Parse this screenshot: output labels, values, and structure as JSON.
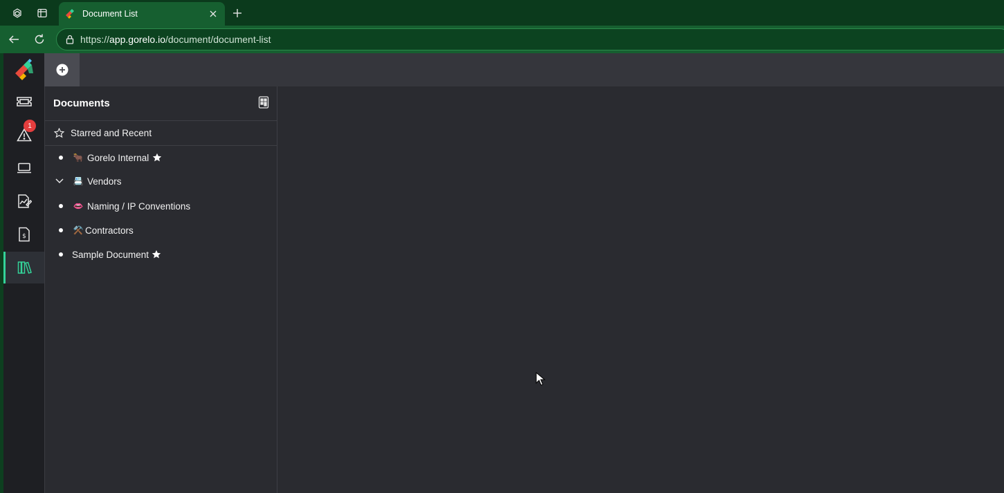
{
  "browser": {
    "tab": {
      "title": "Document List"
    },
    "address": {
      "scheme": "https://",
      "host": "app.gorelo.io",
      "path": "/document/document-list"
    },
    "icons": [
      "workspaces-icon",
      "tab-actions-icon",
      "close-icon",
      "plus-icon",
      "back-icon",
      "reload-icon",
      "lock-icon"
    ]
  },
  "rail": {
    "items": [
      {
        "name": "tickets",
        "icon": "ticket-icon"
      },
      {
        "name": "alerts",
        "icon": "alert-icon",
        "badge": "1"
      },
      {
        "name": "devices",
        "icon": "laptop-icon"
      },
      {
        "name": "reports",
        "icon": "report-icon"
      },
      {
        "name": "billing",
        "icon": "invoice-icon"
      },
      {
        "name": "documents",
        "icon": "library-icon",
        "active": true
      }
    ]
  },
  "panel": {
    "title": "Documents",
    "starred_label": "Starred and Recent",
    "tree": [
      {
        "label": "Gorelo Internal",
        "emoji": "🐂",
        "starred": true,
        "marker": "bullet"
      },
      {
        "label": "Vendors",
        "emoji": "📇",
        "starred": false,
        "marker": "chevron-down"
      },
      {
        "label": "Naming / IP Conventions",
        "emoji": "👄",
        "starred": false,
        "marker": "bullet"
      },
      {
        "label": "Contractors",
        "emoji": "⚒️",
        "starred": false,
        "marker": "bullet"
      },
      {
        "label": "Sample Document",
        "emoji": "",
        "starred": true,
        "marker": "bullet"
      }
    ]
  },
  "colors": {
    "browser_frame": "#0b3a1c",
    "browser_toolbar": "#165f30",
    "app_background": "#2a2b30",
    "rail_background": "#1e1f23",
    "active_accent": "#34d399",
    "badge": "#e53e3e"
  }
}
